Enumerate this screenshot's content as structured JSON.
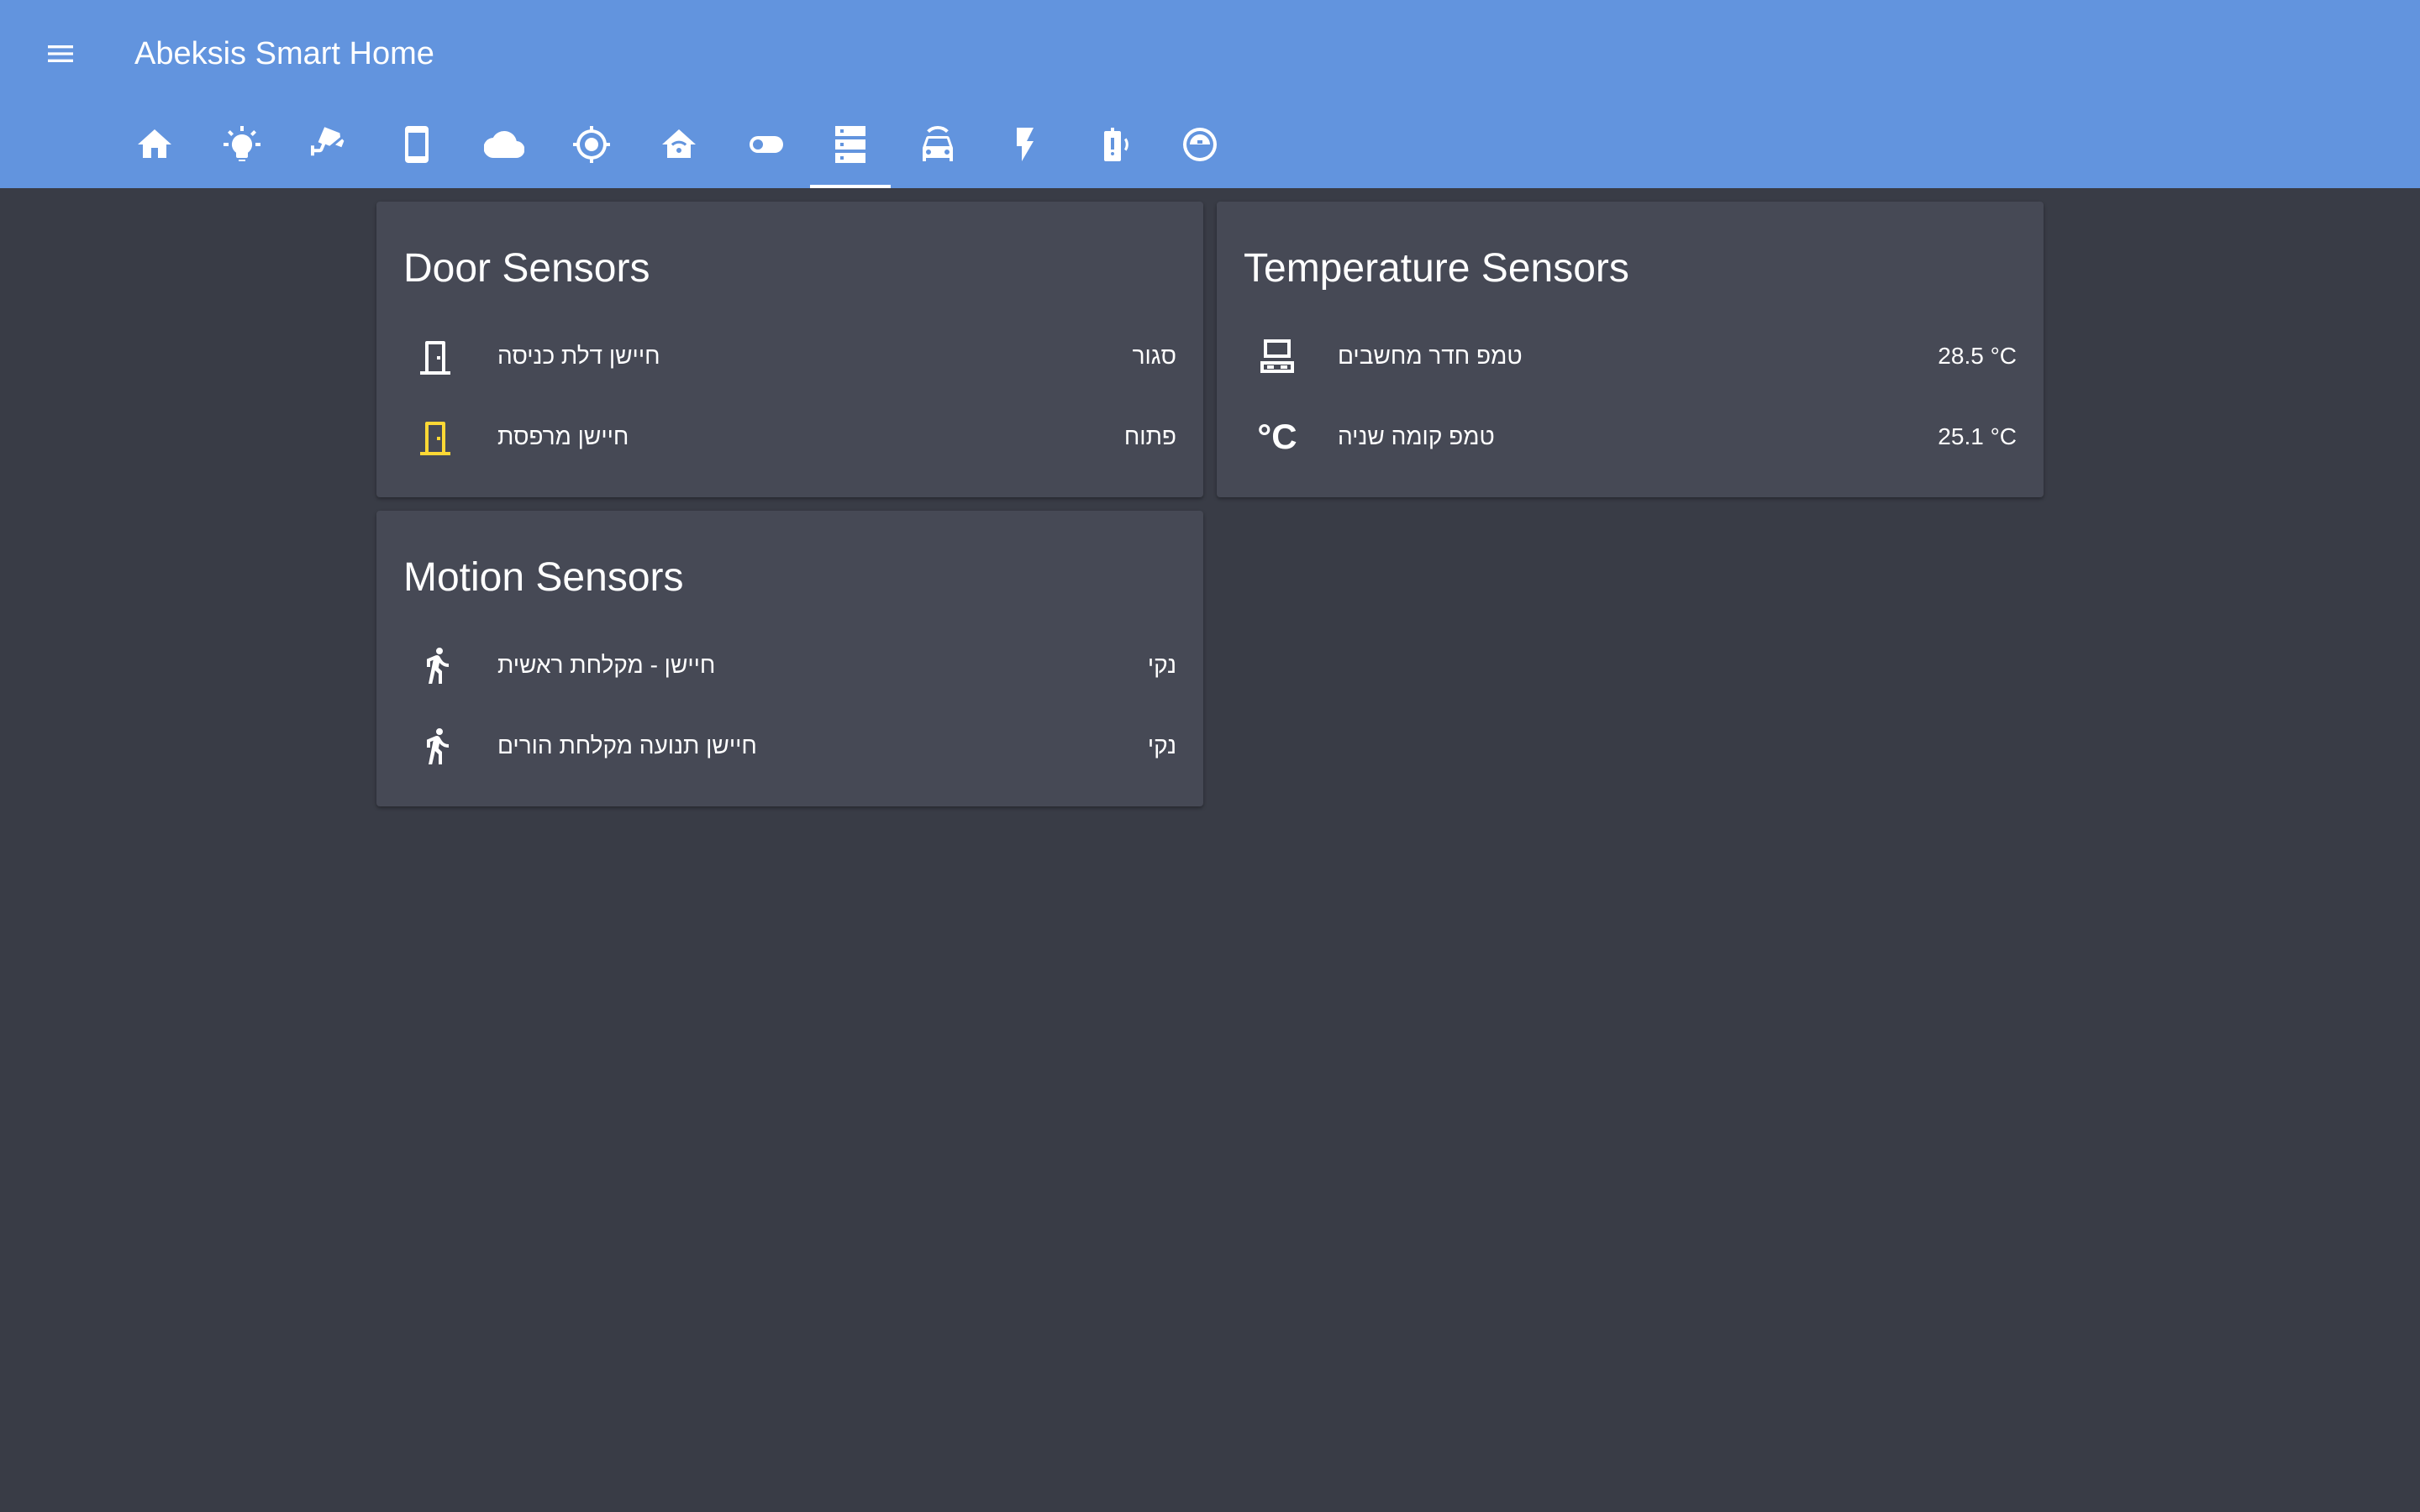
{
  "app": {
    "title": "Abeksis Smart Home"
  },
  "tabs": [
    {
      "icon": "home-icon",
      "selected": false
    },
    {
      "icon": "lightbulb-icon",
      "selected": false
    },
    {
      "icon": "cctv-camera-icon",
      "selected": false
    },
    {
      "icon": "cellphone-icon",
      "selected": false
    },
    {
      "icon": "cloud-icon",
      "selected": false
    },
    {
      "icon": "crosshairs-gps-icon",
      "selected": false
    },
    {
      "icon": "home-wifi-icon",
      "selected": false
    },
    {
      "icon": "toggle-switch-icon",
      "selected": false
    },
    {
      "icon": "server-icon",
      "selected": true
    },
    {
      "icon": "car-connected-icon",
      "selected": false
    },
    {
      "icon": "flash-icon",
      "selected": false
    },
    {
      "icon": "battery-alert-icon",
      "selected": false
    },
    {
      "icon": "robot-vacuum-icon",
      "selected": false
    }
  ],
  "cards": {
    "door": {
      "title": "Door Sensors",
      "rows": [
        {
          "icon": "door-closed-icon",
          "name": "חיישן דלת כניסה",
          "state": "סגור",
          "active": false
        },
        {
          "icon": "door-open-icon",
          "name": "חיישן מרפסת",
          "state": "פתוח",
          "active": true
        }
      ]
    },
    "temperature": {
      "title": "Temperature Sensors",
      "rows": [
        {
          "icon": "desktop-computer-icon",
          "name": "טמפ חדר מחשבים",
          "state": "28.5 °C"
        },
        {
          "icon": "temperature-celsius-icon",
          "name": "טמפ קומה שניה",
          "state": "25.1 °C",
          "glyph": "°C"
        }
      ]
    },
    "motion": {
      "title": "Motion Sensors",
      "rows": [
        {
          "icon": "walk-icon",
          "name": "חיישן - מקלחת ראשית",
          "state": "נקי"
        },
        {
          "icon": "walk-icon",
          "name": "חיישן תנועה מקלחת הורים",
          "state": "נקי"
        }
      ]
    }
  },
  "colors": {
    "header": "#6294de",
    "background": "#393c46",
    "card": "#464955",
    "active_icon": "#fdd835"
  }
}
